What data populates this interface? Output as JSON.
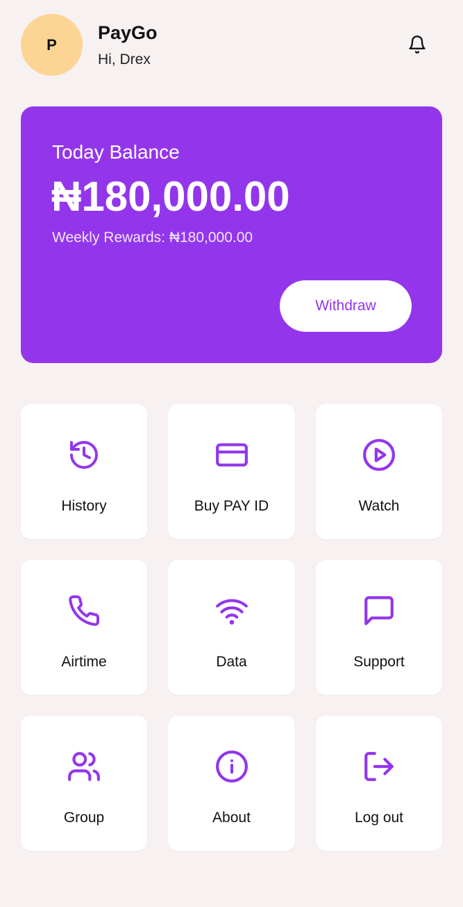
{
  "header": {
    "avatar_initial": "P",
    "app_name": "PayGo",
    "greeting": "Hi, Drex",
    "bell_icon": "bell-icon"
  },
  "balance": {
    "label": "Today Balance",
    "amount": "₦180,000.00",
    "rewards": "Weekly Rewards: ₦180,000.00",
    "withdraw_label": "Withdraw"
  },
  "menu": [
    {
      "label": "History",
      "icon": "history-icon"
    },
    {
      "label": "Buy PAY ID",
      "icon": "card-icon"
    },
    {
      "label": "Watch",
      "icon": "play-icon"
    },
    {
      "label": "Airtime",
      "icon": "phone-icon"
    },
    {
      "label": "Data",
      "icon": "wifi-icon"
    },
    {
      "label": "Support",
      "icon": "chat-icon"
    },
    {
      "label": "Group",
      "icon": "users-icon"
    },
    {
      "label": "About",
      "icon": "info-icon"
    },
    {
      "label": "Log out",
      "icon": "logout-icon"
    }
  ],
  "colors": {
    "accent": "#9336eb",
    "avatar_bg": "#fcd494",
    "page_bg": "#f8f1f1",
    "tile_bg": "#ffffff"
  }
}
